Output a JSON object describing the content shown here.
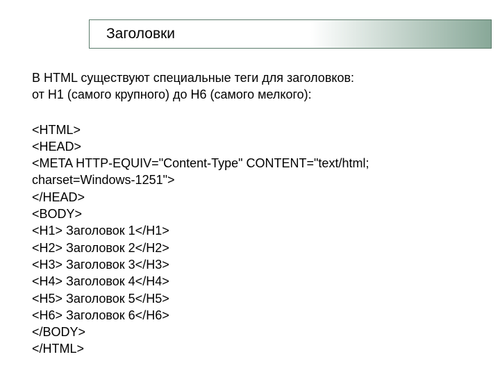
{
  "title": "Заголовки",
  "description": {
    "line1": "В HTML существуют специальные теги для заголовков:",
    "line2": "от Н1 (самого крупного) до Н6 (самого мелкого):"
  },
  "code": {
    "l1": "<HTML>",
    "l2": "<HEAD>",
    "l3": "<META HTTP-EQUIV=\"Content-Type\" CONTENT=\"text/html;",
    "l4": "charset=Windows-1251\">",
    "l5": "</HEAD>",
    "l6": "<BODY>",
    "l7": "<H1> Заголовок 1</H1>",
    "l8": "<H2> Заголовок 2</H2>",
    "l9": "<H3> Заголовок 3</H3>",
    "l10": "<H4> Заголовок 4</H4>",
    "l11": "<H5> Заголовок 5</H5>",
    "l12": "<H6> Заголовок 6</H6>",
    "l13": "</BODY>",
    "l14": "</HTML>"
  }
}
